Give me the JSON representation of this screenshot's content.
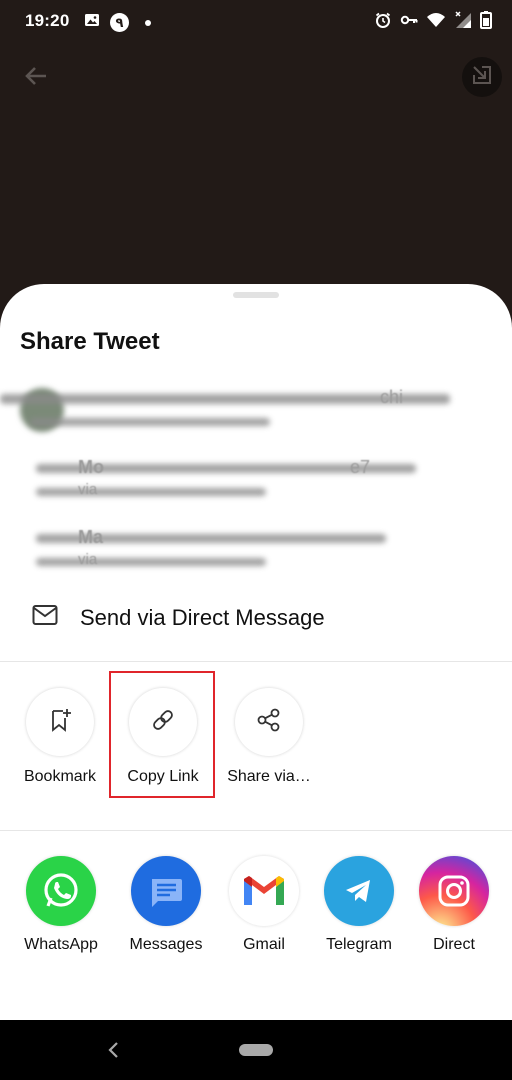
{
  "status_bar": {
    "time": "19:20",
    "notification_badge": "٩",
    "icons": [
      "image-icon",
      "notification-badge-icon",
      "dot-icon",
      "alarm-icon",
      "vpn-key-icon",
      "wifi-icon",
      "signal-icon",
      "battery-icon"
    ]
  },
  "top": {
    "icons": [
      "back-arrow-icon",
      "media-corner-icon"
    ]
  },
  "sheet": {
    "title": "Share Tweet",
    "blurred_rows": [
      {
        "visible_text": "chi"
      },
      {
        "visible_text_1": "Mo",
        "visible_text_2": "e7",
        "visible_text_3": "via"
      },
      {
        "visible_text_1": "Ma",
        "visible_text_3": "via"
      }
    ],
    "direct_message": {
      "label": "Send via Direct Message",
      "icon": "envelope-icon"
    }
  },
  "actions": [
    {
      "label": "Bookmark",
      "icon": "bookmark-add-icon"
    },
    {
      "label": "Copy Link",
      "icon": "link-icon"
    },
    {
      "label": "Share via…",
      "icon": "share-icon"
    }
  ],
  "apps": [
    {
      "label": "WhatsApp",
      "icon": "whatsapp-icon",
      "color": "#25d366"
    },
    {
      "label": "Messages",
      "icon": "messages-icon",
      "color": "#1a73e8"
    },
    {
      "label": "Gmail",
      "icon": "gmail-icon",
      "color": "#ea4335"
    },
    {
      "label": "Telegram",
      "icon": "telegram-icon",
      "color": "#2aa3df"
    },
    {
      "label": "Direct",
      "icon": "instagram-icon",
      "color": "#d62976"
    }
  ],
  "highlight_color": "#e0252b"
}
